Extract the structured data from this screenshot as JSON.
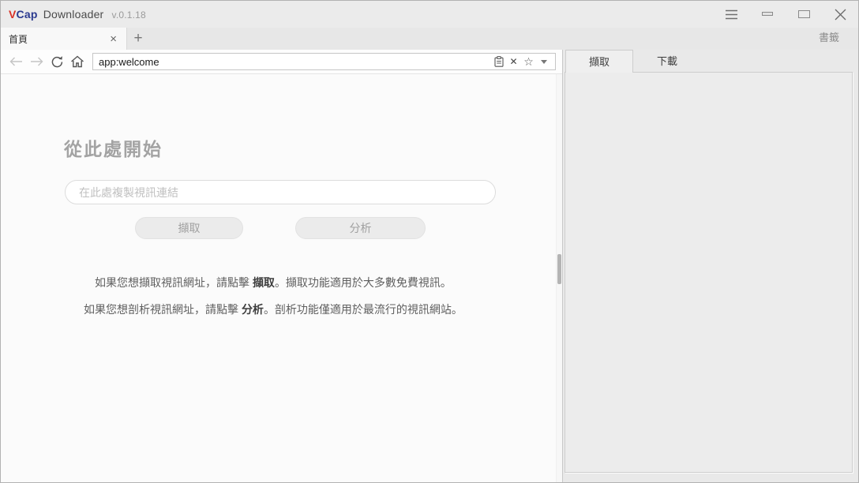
{
  "titlebar": {
    "logo_v": "V",
    "logo_cap": "Cap",
    "logo_rest": "Downloader",
    "version": "v.0.1.18",
    "bookmarks_label": "書籤"
  },
  "browser": {
    "tab_label": "首頁",
    "tab_close_glyph": "×",
    "new_tab_glyph": "+",
    "address_value": "app:welcome",
    "clear_glyph": "✕",
    "bookmark_star_glyph": "☆"
  },
  "welcome": {
    "heading": "從此處開始",
    "input_placeholder": "在此處複製視訊連結",
    "capture_button": "擷取",
    "analyze_button": "分析",
    "line1_pre": "如果您想擷取視訊網址，請點擊 ",
    "line1_bold": "擷取",
    "line1_post": "。擷取功能適用於大多數免費視訊。",
    "line2_pre": "如果您想剖析視訊網址，請點擊 ",
    "line2_bold": "分析",
    "line2_post": "。剖析功能僅適用於最流行的視訊網站。"
  },
  "panel": {
    "tabs": [
      {
        "label": "擷取",
        "active": true
      },
      {
        "label": "下載",
        "active": false
      }
    ]
  },
  "colors": {
    "logo_red": "#d93025",
    "logo_blue": "#2b3a8f",
    "chrome_bg": "#ebebeb",
    "content_bg": "#fbfbfb",
    "panel_bg": "#ececec"
  }
}
